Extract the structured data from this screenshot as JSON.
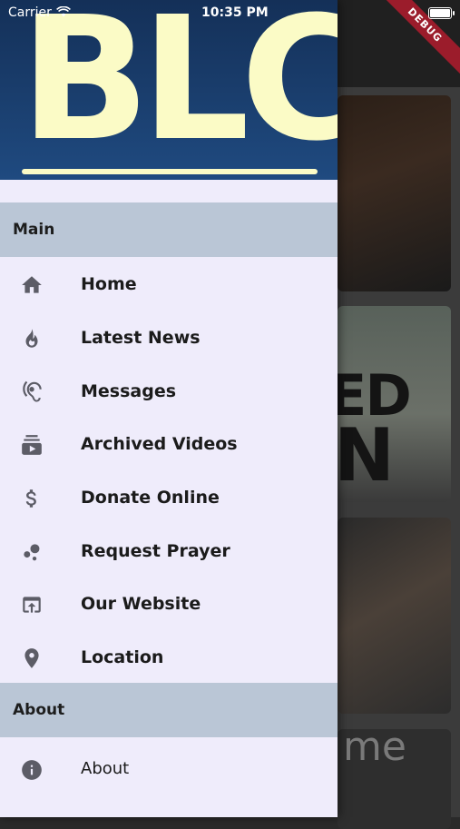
{
  "status_bar": {
    "carrier": "Carrier",
    "time": "10:35 PM"
  },
  "debug_banner": "DEBUG",
  "drawer": {
    "logo_text": "BLC",
    "sections": [
      {
        "title": "Main",
        "items": [
          {
            "label": "Home",
            "icon": "home-icon"
          },
          {
            "label": "Latest News",
            "icon": "fire-icon"
          },
          {
            "label": "Messages",
            "icon": "hearing-icon"
          },
          {
            "label": "Archived Videos",
            "icon": "subscriptions-icon"
          },
          {
            "label": "Donate Online",
            "icon": "dollar-icon"
          },
          {
            "label": "Request Prayer",
            "icon": "bubbles-icon"
          },
          {
            "label": "Our Website",
            "icon": "open-in-browser-icon"
          },
          {
            "label": "Location",
            "icon": "location-pin-icon"
          }
        ]
      },
      {
        "title": "About",
        "items": [
          {
            "label": "About",
            "icon": "info-icon"
          }
        ]
      }
    ]
  },
  "background": {
    "card_text_1": "ED",
    "card_text_2": "N",
    "card_text_3": "me"
  }
}
